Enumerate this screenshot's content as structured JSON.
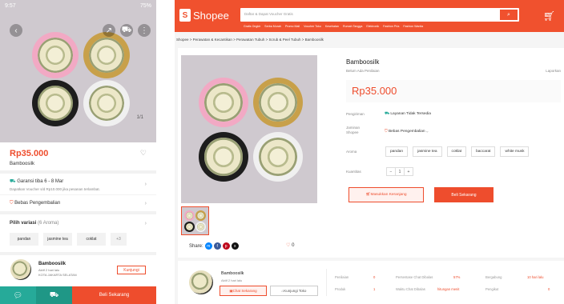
{
  "mobile": {
    "status_time": "9:57",
    "status_right": "75%",
    "image_counter": "1/1",
    "price": "Rp35.000",
    "title": "Bamboosilk",
    "guarantee_title": "Garansi tiba 6 - 8 Mar",
    "guarantee_sub": "Dapatkan Voucher s/d Rp10.000 jika pesanan terlambat.",
    "free_return": "Bebas Pengembalian",
    "variant_label": "Pilih variasi",
    "variant_count": "(6 Aroma)",
    "variants": [
      "pandan",
      "jasmine tea",
      "coklat",
      "+3"
    ],
    "shop_name": "Bamboosilk",
    "shop_meta_1": "Aktif 2 hari lalu",
    "shop_meta_2": "KOTA JAKARTA SELATAN",
    "visit_label": "Kunjungi",
    "buy_label": "Beli Sekarang"
  },
  "desktop": {
    "logo_text": "Shopee",
    "search_placeholder": "Daftar & Dapat Voucher Gratis",
    "search_links": [
      "Gratis Ongkir",
      "Serba Murah",
      "Promo Mall",
      "Voucher Toko",
      "Kesehatan",
      "Rumah Tangga",
      "Elektronik",
      "Fashion Pria",
      "Fashion Wanita"
    ],
    "breadcrumb": "Shopee  >  Perawatan & Kecantikan  >  Perawatan Tubuh  >  Scrub & Peel Tubuh  >  Bamboosilk",
    "share_label": "Share:",
    "like_count": "0",
    "product_name": "Bamboosilk",
    "product_sub": "Belum Ada Penilaian",
    "report_label": "Laporkan",
    "price": "Rp35.000",
    "shipping_label": "Pengiriman",
    "shipping_value": "Layanan Tidak Tersedia",
    "guarantee_label_1": "Jaminan",
    "guarantee_label_2": "Shopee",
    "guarantee_value": "Bebas Pengembalian",
    "aroma_label": "Aroma",
    "aromas": [
      "pandan",
      "jasmine tea",
      "coklat",
      "baccarat",
      "white musk"
    ],
    "qty_label": "Kuantitas",
    "qty_value": "1",
    "qty_minus": "−",
    "qty_plus": "+",
    "add_cart_label": "Masukkan Keranjang",
    "buy_label": "Beli Sekarang",
    "shop_name": "Bamboosilk",
    "shop_meta": "Aktif 2 hari lalu",
    "chat_label": "Chat Sekarang",
    "visit_label": "Kunjungi Toko",
    "stats": [
      {
        "label": "Penilaian",
        "value": "0"
      },
      {
        "label": "Persentase Chat Dibalas",
        "value": "57%"
      },
      {
        "label": "Bergabung",
        "value": "10 hari lalu"
      },
      {
        "label": "Produk",
        "value": "1"
      },
      {
        "label": "Waktu Chat Dibalas",
        "value": "hitungan menit"
      },
      {
        "label": "Pengikut",
        "value": "0"
      }
    ]
  },
  "colors": {
    "brand": "#ee4d2d",
    "chat_teal": "#26aa99"
  },
  "icons": {
    "back": "chevron-left-icon",
    "share": "share-icon",
    "cart": "cart-icon",
    "heart": "heart-icon",
    "search": "search-icon"
  }
}
